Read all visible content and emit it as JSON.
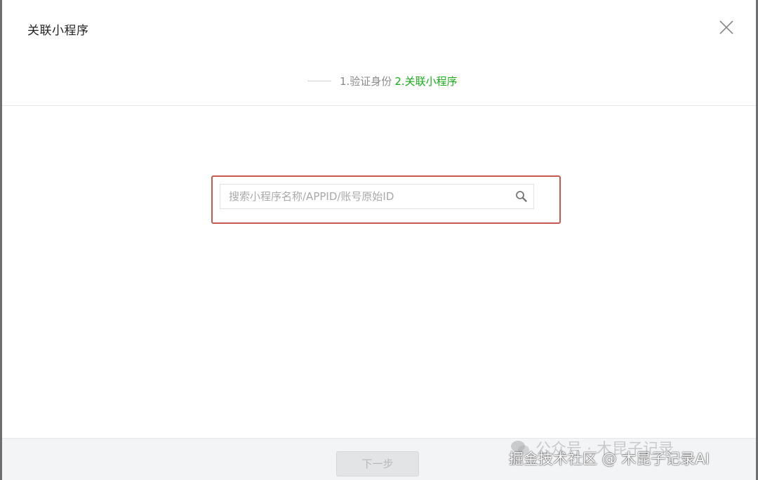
{
  "dialog": {
    "title": "关联小程序"
  },
  "steps": {
    "step1": "1.验证身份",
    "step2": "2.关联小程序"
  },
  "search": {
    "placeholder": "搜索小程序名称/APPID/账号原始ID",
    "value": ""
  },
  "footer": {
    "next_label": "下一步"
  },
  "watermark": {
    "back_text": "公众号 · 木昆子记录",
    "front_text": "掘金技术社区 @ 木昆子记录AI"
  },
  "colors": {
    "step_active": "#1aad19",
    "highlight_border": "#c9574f"
  },
  "icons": {
    "close": "close-icon",
    "search": "search-icon",
    "wechat": "wechat-icon"
  }
}
